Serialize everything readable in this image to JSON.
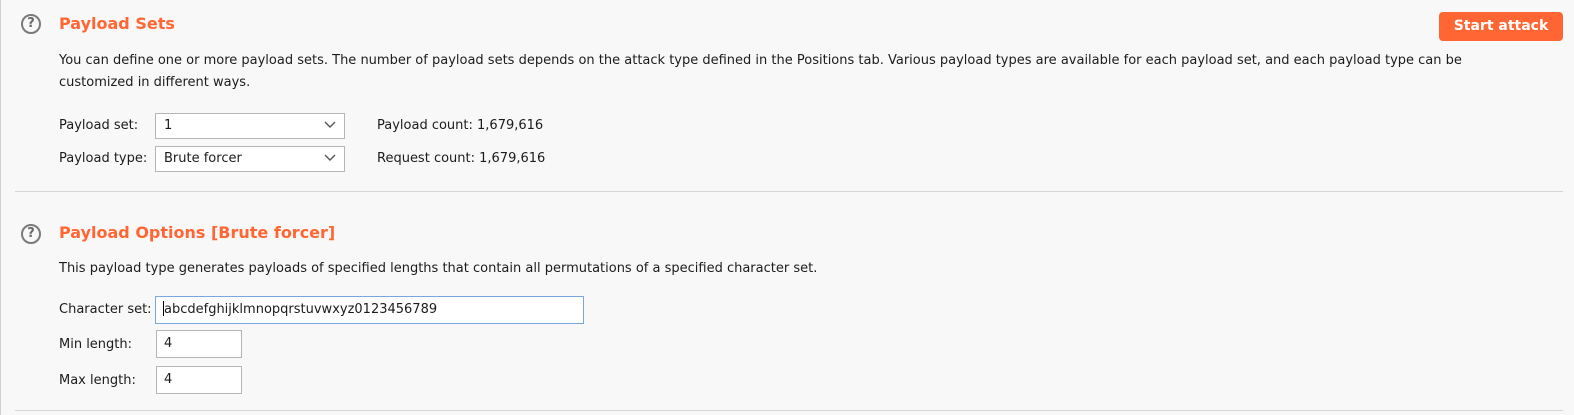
{
  "payload_sets": {
    "title": "Payload Sets",
    "description": "You can define one or more payload sets. The number of payload sets depends on the attack type defined in the Positions tab. Various payload types are available for each payload set, and each payload type can be customized in different ways.",
    "start_attack_label": "Start attack",
    "payload_set_label": "Payload set:",
    "payload_set_value": "1",
    "payload_type_label": "Payload type:",
    "payload_type_value": "Brute forcer",
    "payload_count": "Payload count: 1,679,616",
    "request_count": "Request count: 1,679,616"
  },
  "payload_options": {
    "title": "Payload Options [Brute forcer]",
    "description": "This payload type generates payloads of specified lengths that contain all permutations of a specified character set.",
    "character_set_label": "Character set:",
    "character_set_value": "abcdefghijklmnopqrstuvwxyz0123456789",
    "min_length_label": "Min length:",
    "min_length_value": "4",
    "max_length_label": "Max length:",
    "max_length_value": "4"
  },
  "icons": {
    "help_glyph": "?"
  },
  "colors": {
    "accent": "#ff6633",
    "background": "#f8f8f8",
    "focus_border": "#7aa7d9"
  }
}
